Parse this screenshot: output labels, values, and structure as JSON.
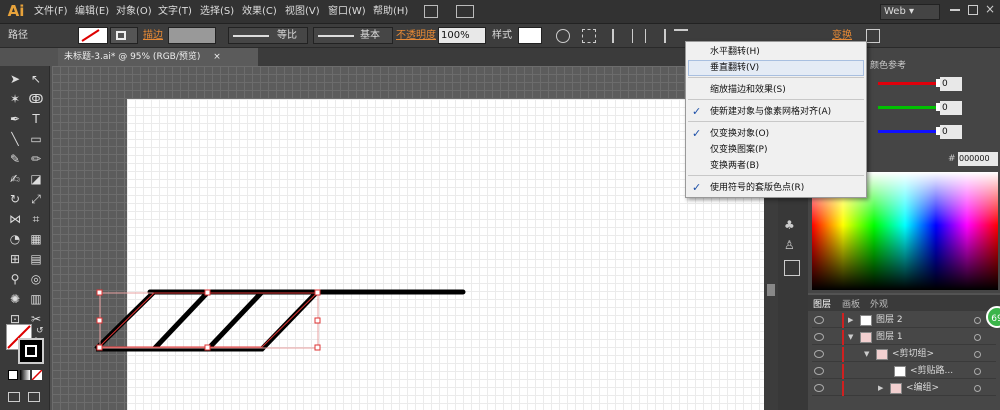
{
  "app": {
    "logo": "Ai"
  },
  "menus": [
    "文件(F)",
    "编辑(E)",
    "对象(O)",
    "文字(T)",
    "选择(S)",
    "效果(C)",
    "视图(V)",
    "窗口(W)",
    "帮助(H)"
  ],
  "workspace": {
    "label": "Web"
  },
  "control": {
    "path_label": "路径",
    "stroke_label": "描边",
    "stroke_weight": "",
    "profile_equal": "等比",
    "profile_basic": "基本",
    "opacity_label": "不透明度",
    "opacity_value": "100%",
    "style_label": "样式",
    "transform_label": "变换"
  },
  "doc_tab": {
    "title": "未标题-3.ai* @ 95% (RGB/预览)",
    "close": "×"
  },
  "dropdown": {
    "items": [
      {
        "label": "水平翻转(H)",
        "checked": false
      },
      {
        "label": "垂直翻转(V)",
        "checked": false,
        "highlighted": true
      },
      {
        "label": "缩放描边和效果(S)",
        "checked": false
      },
      {
        "label": "使新建对象与像素网格对齐(A)",
        "checked": true
      },
      {
        "label": "仅变换对象(O)",
        "checked": true
      },
      {
        "label": "仅变换图案(P)",
        "checked": false
      },
      {
        "label": "变换两者(B)",
        "checked": false
      },
      {
        "label": "使用符号的套版色点(R)",
        "checked": true
      }
    ]
  },
  "color_panel": {
    "tab": "颜色参考",
    "r_value": "0",
    "g_value": "0",
    "b_value": "0",
    "hex_prefix": "#",
    "hex_value": "000000",
    "colors": {
      "r": "#e0000b",
      "g": "#00c000",
      "b": "#1010ff"
    }
  },
  "layers_panel": {
    "tabs": [
      "图层",
      "画板",
      "外观"
    ],
    "rows": [
      {
        "name": "图层 2",
        "expand": "▶",
        "color": "#d02020",
        "thumb": "#ffffff"
      },
      {
        "name": "图层 1",
        "expand": "▼",
        "color": "#d02020",
        "thumb": "#f2d0d0"
      },
      {
        "name": "<剪切组>",
        "expand": "▼",
        "color": "#d02020",
        "thumb": "#f2d0d0"
      },
      {
        "name": "<剪贴路...",
        "expand": "",
        "color": "#d02020",
        "thumb": "#ffffff"
      },
      {
        "name": "<编组>",
        "expand": "▶",
        "color": "#d02020",
        "thumb": "#f2d0d0"
      }
    ],
    "badge": "69"
  },
  "accent": "#e05a00"
}
